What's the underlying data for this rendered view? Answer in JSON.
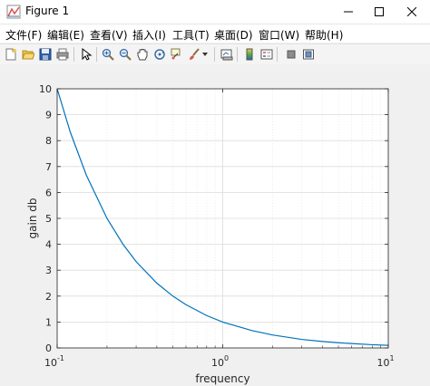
{
  "window": {
    "title": "Figure 1",
    "controls": {
      "minimize": "─",
      "maximize": "☐",
      "close": "✕"
    }
  },
  "menu": {
    "items": [
      {
        "label": "文件(F)"
      },
      {
        "label": "编辑(E)"
      },
      {
        "label": "查看(V)"
      },
      {
        "label": "插入(I)"
      },
      {
        "label": "工具(T)"
      },
      {
        "label": "桌面(D)"
      },
      {
        "label": "窗口(W)"
      },
      {
        "label": "帮助(H)"
      }
    ]
  },
  "toolbar": {
    "icons": [
      "new-figure-icon",
      "open-file-icon",
      "save-icon",
      "print-icon",
      "pointer-icon",
      "zoom-in-icon",
      "zoom-out-icon",
      "pan-icon",
      "rotate-3d-icon",
      "data-cursor-icon",
      "brush-icon",
      "brush-dropdown-icon",
      "link-plot-icon",
      "colorbar-icon",
      "legend-icon",
      "hide-plot-tools-icon",
      "show-plot-tools-icon"
    ]
  },
  "chart_data": {
    "type": "line",
    "xscale": "log",
    "xlim": [
      0.1,
      10
    ],
    "ylim": [
      0,
      10
    ],
    "xlabel": "frequency",
    "ylabel": "gain db",
    "x_ticks": [
      {
        "base": "10",
        "exp": "-1",
        "value": 0.1
      },
      {
        "base": "10",
        "exp": "0",
        "value": 1
      },
      {
        "base": "10",
        "exp": "1",
        "value": 10
      }
    ],
    "y_ticks": [
      "0",
      "1",
      "2",
      "3",
      "4",
      "5",
      "6",
      "7",
      "8",
      "9",
      "10"
    ],
    "grid": true,
    "minor_grid": true,
    "line_color": "#0072bd",
    "series": [
      {
        "x": [
          0.1,
          0.12,
          0.15,
          0.2,
          0.25,
          0.3,
          0.4,
          0.5,
          0.6,
          0.8,
          1,
          1.5,
          2,
          3,
          4,
          5,
          6,
          8,
          10
        ],
        "values": [
          10,
          8.33,
          6.67,
          5,
          4,
          3.33,
          2.5,
          2,
          1.67,
          1.25,
          1,
          0.67,
          0.5,
          0.33,
          0.25,
          0.2,
          0.17,
          0.125,
          0.1
        ]
      }
    ]
  }
}
